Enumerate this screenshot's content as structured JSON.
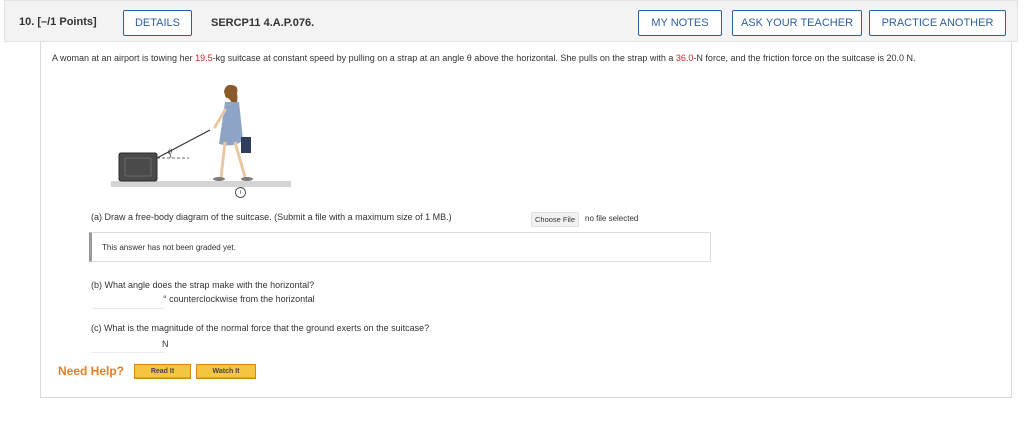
{
  "header": {
    "question_number": "10.  [–/1 Points]",
    "details_label": "DETAILS",
    "code": "SERCP11 4.A.P.076.",
    "my_notes_label": "MY NOTES",
    "ask_teacher_label": "ASK YOUR TEACHER",
    "practice_another_label": "PRACTICE ANOTHER"
  },
  "problem": {
    "text_1": "A woman at an airport is towing her ",
    "mass_value": "19.5",
    "text_2": "-kg suitcase at constant speed by pulling on a strap at an angle θ above the horizontal. She pulls on the strap with a ",
    "force_value": "36.0",
    "text_3": "-N force, and the friction force on the suitcase is 20.0 N.",
    "angle_symbol": "θ"
  },
  "part_a": {
    "question": "(a) Draw a free-body diagram of the suitcase. (Submit a file with a maximum size of 1 MB.)",
    "choose_file_label": "Choose File",
    "no_file_text": "no file selected",
    "graded_text": "This answer has not been graded yet."
  },
  "part_b": {
    "question": "(b) What angle does the strap make with the horizontal?",
    "unit": "° counterclockwise from the horizontal"
  },
  "part_c": {
    "question": "(c) What is the magnitude of the normal force that the ground exerts on the suitcase?",
    "unit": "N"
  },
  "help": {
    "label": "Need Help?",
    "read_it_label": "Read It",
    "watch_it_label": "Watch It"
  },
  "colors": {
    "accent_blue": "#2f5f9e",
    "value_red": "#c8262b",
    "help_orange": "#e67e22",
    "help_button_gold": "#f5c542"
  },
  "icons": [
    "info-icon"
  ]
}
